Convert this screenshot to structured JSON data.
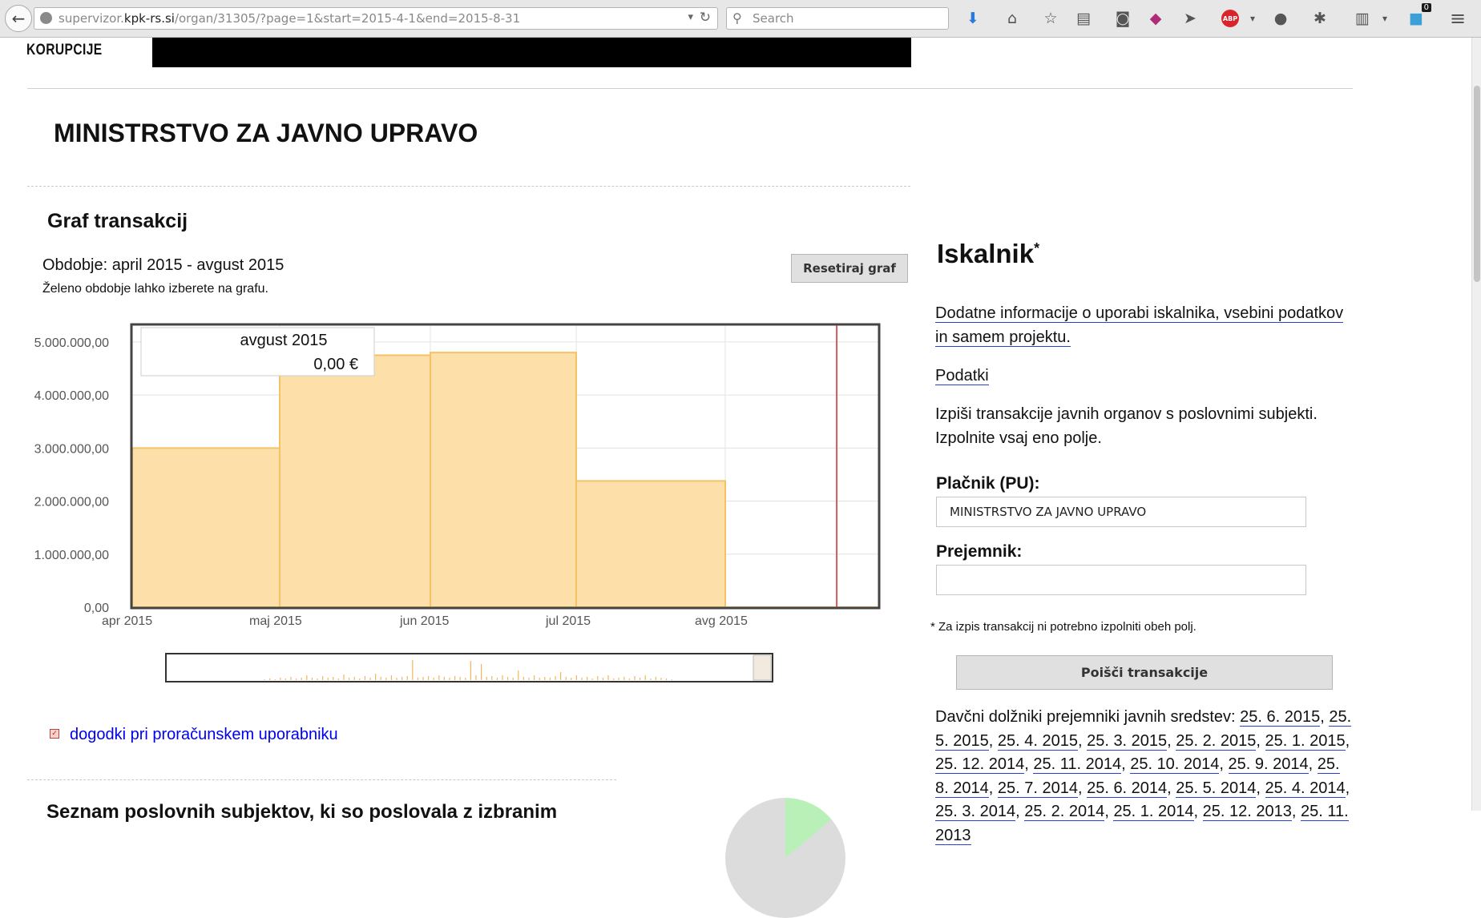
{
  "browser": {
    "url_prefix": "supervizor.",
    "url_domain": "kpk-rs.si",
    "url_path": "/organ/31305/?page=1&start=2015-4-1&end=2015-8-31",
    "search_placeholder": "Search",
    "abp_label": "ABP",
    "notification_count": "0",
    "back_glyph": "←",
    "reload_glyph": "↻",
    "dropdown_glyph": "▾",
    "search_glyph": "⚲",
    "download_glyph": "⬇",
    "home_glyph": "⌂",
    "star_glyph": "☆",
    "reader_glyph": "▤",
    "pocket_glyph": "◙",
    "send_glyph": "➤",
    "chat_glyph": "●",
    "addon_glyph": "✱",
    "clip_glyph": "▥",
    "menu_glyph": "≡",
    "ext_glyph": "◆"
  },
  "header": {
    "logo_text": "KORUPCIJE"
  },
  "page": {
    "title": "MINISTRSTVO ZA JAVNO UPRAVO",
    "section_title": "Graf transakcij",
    "period": "Obdobje: april 2015 - avgust 2015",
    "period_hint": "Želeno obdobje lahko izberete na grafu.",
    "reset_button": "Resetiraj graf",
    "tooltip_month": "avgust 2015",
    "tooltip_value": "0,00 €",
    "events_check": "✓",
    "events_link": "dogodki pri proračunskem uporabniku",
    "partial_heading": "Seznam poslovnih subjektov, ki so poslovala z izbranim"
  },
  "chart_data": {
    "type": "bar",
    "categories": [
      "apr 2015",
      "maj 2015",
      "jun 2015",
      "jul 2015",
      "avg 2015"
    ],
    "values": [
      3000000,
      4750000,
      4800000,
      2380000,
      0
    ],
    "yticks": [
      "0,00",
      "1.000.000,00",
      "2.000.000,00",
      "3.000.000,00",
      "4.000.000,00",
      "5.000.000,00"
    ],
    "ylim": [
      0,
      5300000
    ],
    "grid": true,
    "bar_color": "#fddfaa",
    "bar_stroke": "#f5c266",
    "marker_color": "#cc3333"
  },
  "sidebar": {
    "title": "Iskalnik",
    "title_sup": "*",
    "info_link": "Dodatne informacije o uporabi iskalnika, vsebini podatkov in samem projektu.",
    "data_link": "Podatki",
    "desc_line1": "Izpiši transakcije javnih organov s poslovnimi subjekti.",
    "desc_line2": "Izpolnite vsaj eno polje.",
    "payer_label": "Plačnik (PU):",
    "payer_value": "MINISTRSTVO ZA JAVNO UPRAVO",
    "recipient_label": "Prejemnik:",
    "recipient_value": "",
    "note": "* Za izpis transakcij ni potrebno izpolniti obeh polj.",
    "find_button": "Poišči transakcije",
    "debtors_intro": "Davčni dolžniki prejemniki javnih sredstev:",
    "debtor_dates": [
      "25. 6. 2015",
      "25. 5. 2015",
      "25. 4. 2015",
      "25. 3. 2015",
      "25. 2. 2015",
      "25. 1. 2015",
      "25. 12. 2014",
      "25. 11. 2014",
      "25. 10. 2014",
      "25. 9. 2014",
      "25. 8. 2014",
      "25. 7. 2014",
      "25. 6. 2014",
      "25. 5. 2014",
      "25. 4. 2014",
      "25. 3. 2014",
      "25. 2. 2014",
      "25. 1. 2014",
      "25. 12. 2013",
      "25. 11. 2013"
    ]
  }
}
